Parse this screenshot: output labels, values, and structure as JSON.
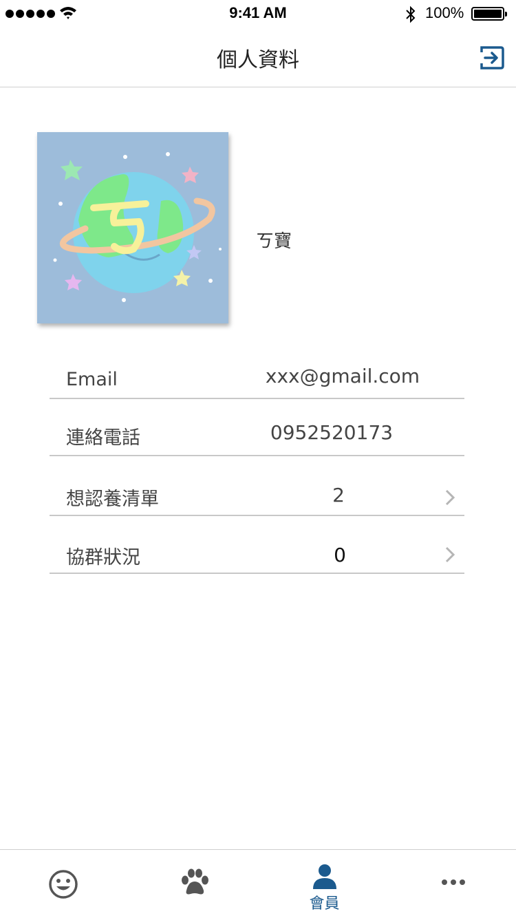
{
  "status_bar": {
    "time": "9:41 AM",
    "battery": "100%"
  },
  "nav": {
    "title": "個人資料",
    "right_icon": "logout-icon"
  },
  "profile": {
    "nickname": "ㄎ寶",
    "avatar_letter": "ㄎ"
  },
  "info": [
    {
      "label": "Email",
      "value": "xxx@gmail.com"
    },
    {
      "label": "連絡電話",
      "value": "0952520173"
    },
    {
      "label": "想認養清單",
      "value": "2"
    },
    {
      "label": "協群狀況",
      "value": "0"
    }
  ],
  "tabs": [
    {
      "icon": "smiley-icon",
      "label": ""
    },
    {
      "icon": "paw-icon",
      "label": ""
    },
    {
      "icon": "person-icon",
      "label": "會員"
    },
    {
      "icon": "more-icon",
      "label": ""
    }
  ],
  "colors": {
    "accent": "#1b5a8e",
    "avatar_bg": "#9dbcda",
    "divider": "#c8c8c8"
  }
}
